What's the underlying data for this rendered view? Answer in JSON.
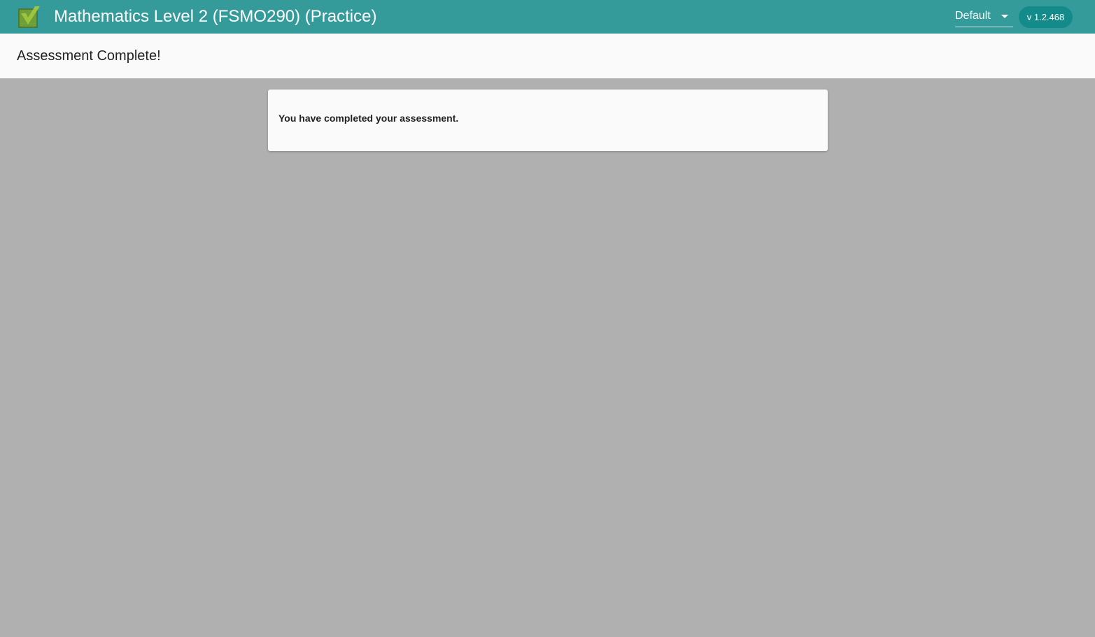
{
  "header": {
    "title": "Mathematics Level 2 (FSMO290) (Practice)",
    "logo_icon": "checkmark-box-icon",
    "theme_select": {
      "value": "Default",
      "icon": "caret-down-icon"
    },
    "version": "v 1.2.468"
  },
  "subheader": {
    "title": "Assessment Complete!"
  },
  "card": {
    "message": "You have completed your assessment."
  },
  "colors": {
    "header_bg": "#359b9a",
    "version_badge_bg": "#138b8a",
    "page_bg": "#b0b0b0",
    "surface": "#fafafa",
    "logo_green": "#8fb83a",
    "logo_dark": "#567f2e"
  }
}
